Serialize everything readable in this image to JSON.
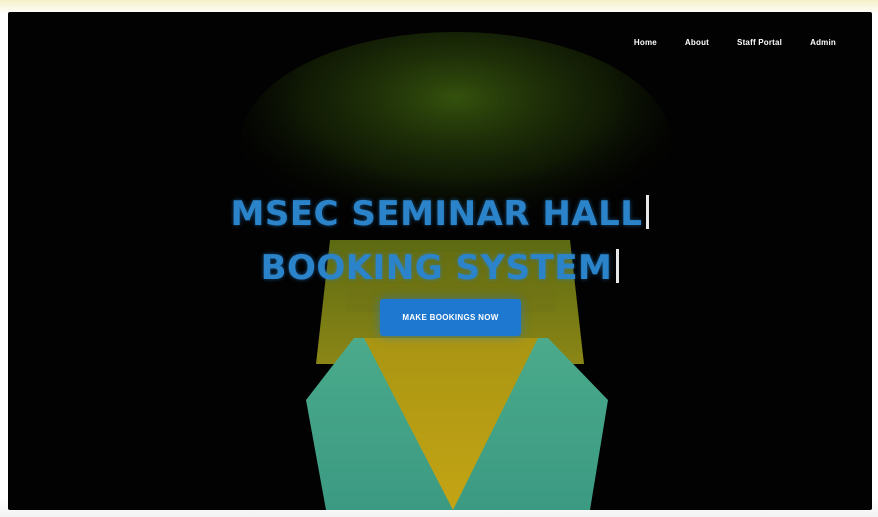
{
  "nav": {
    "links": [
      {
        "label": "Home"
      },
      {
        "label": "About"
      },
      {
        "label": "Staff Portal"
      },
      {
        "label": "Admin"
      }
    ]
  },
  "hero": {
    "title_line1": "MSEC SEMINAR HALL",
    "title_line2": "BOOKING SYSTEM",
    "cta_label": "MAKE BOOKINGS NOW"
  },
  "colors": {
    "background": "#020202",
    "title": "#2b84c9",
    "button": "#1f78cf",
    "hall_yellow": "#b8a412",
    "hall_teal": "#43a48c"
  }
}
